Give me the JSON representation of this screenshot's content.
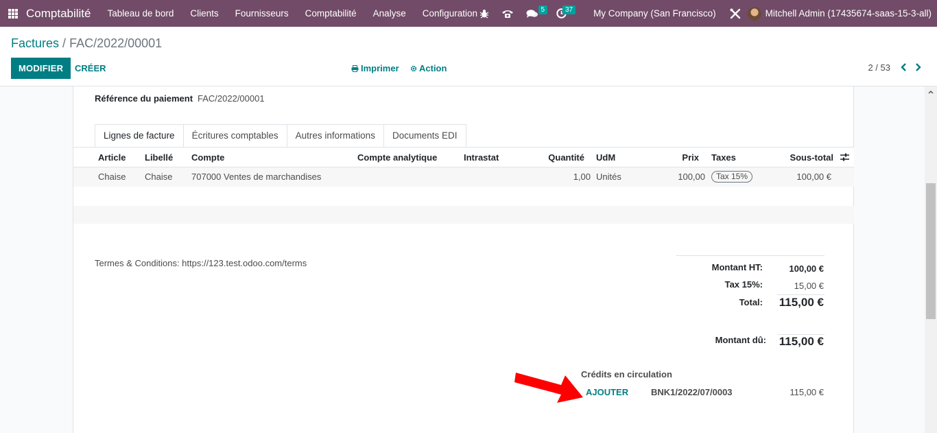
{
  "navbar": {
    "app_name": "Comptabilité",
    "menu": [
      "Tableau de bord",
      "Clients",
      "Fournisseurs",
      "Comptabilité",
      "Analyse",
      "Configuration"
    ],
    "messages_count": "5",
    "activities_count": "37",
    "company": "My Company (San Francisco)",
    "user": "Mitchell Admin (17435674-saas-15-3-all)"
  },
  "breadcrumb": {
    "parent": "Factures",
    "separator": "/",
    "current": "FAC/2022/00001"
  },
  "toolbar": {
    "edit_label": "MODIFIER",
    "create_label": "CRÉER",
    "print_label": "Imprimer",
    "action_label": "Action",
    "pager": "2 / 53"
  },
  "form": {
    "payment_ref_label": "Référence du paiement",
    "payment_ref_value": "FAC/2022/00001",
    "tabs": [
      "Lignes de facture",
      "Écritures comptables",
      "Autres informations",
      "Documents EDI"
    ]
  },
  "lines": {
    "headers": [
      "Article",
      "Libellé",
      "Compte",
      "Compte analytique",
      "Intrastat",
      "Quantité",
      "UdM",
      "Prix",
      "Taxes",
      "Sous-total"
    ],
    "rows": [
      {
        "article": "Chaise",
        "libelle": "Chaise",
        "compte": "707000 Ventes de marchandises",
        "quantite": "1,00",
        "udm": "Unités",
        "prix": "100,00",
        "taxes": "Tax 15%",
        "sous_total": "100,00 €"
      }
    ]
  },
  "terms": "Termes & Conditions: https://123.test.odoo.com/terms",
  "totals": {
    "ht_label": "Montant HT:",
    "ht_value": "100,00 €",
    "tax_label": "Tax 15%:",
    "tax_value": "15,00 €",
    "total_label": "Total:",
    "total_value": "115,00 €",
    "due_label": "Montant dû:",
    "due_value": "115,00 €"
  },
  "credits": {
    "title": "Crédits en circulation",
    "add_label": "AJOUTER",
    "reference": "BNK1/2022/07/0003",
    "amount": "115,00 €"
  },
  "colors": {
    "navbar": "#714b67",
    "primary": "#017e84",
    "arrow": "#ff0000"
  }
}
